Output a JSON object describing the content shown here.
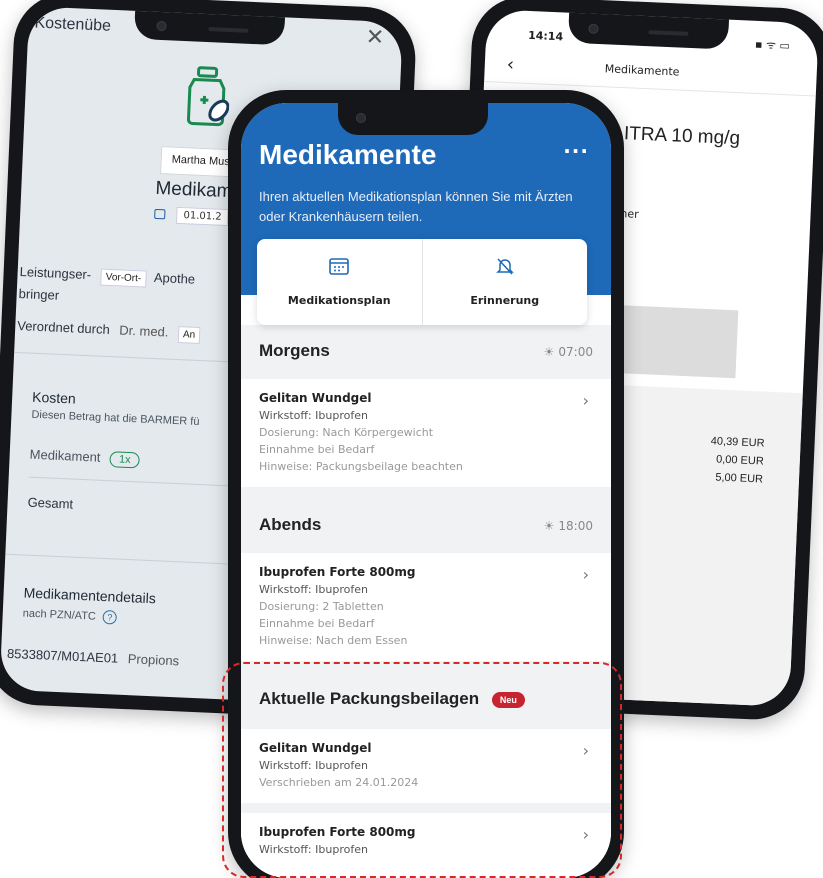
{
  "left_phone": {
    "title": "Kostenübe",
    "close": "✕",
    "patient_name": "Martha Mus",
    "heading": "Medikam",
    "date": "01.01.2",
    "provider_label_1": "Leistungser-",
    "provider_label_2": "bringer",
    "provider_chip": "Vor-Ort-",
    "provider_value": "Apothe",
    "prescribed_label": "Verordnet durch",
    "prescribed_value": "Dr. med.",
    "prescribed_chip": "An",
    "costs_label": "Kosten",
    "costs_desc": "Diesen Betrag hat die BARMER fü",
    "medication_label": "Medikament",
    "medication_count": "1x",
    "total_label": "Gesamt",
    "details_label": "Medikamentendetails",
    "details_sub": "nach PZN/ATC",
    "help": "?",
    "pzn": "8533807/M01AE01",
    "pzn_suffix": "Propions"
  },
  "right_phone": {
    "time": "14:14",
    "status": "▪ ᯤ ▭",
    "back": "‹",
    "nav_title": "Medikamente",
    "drug_name": "ITRA 10 mg/g",
    "ner_text": "ner",
    "amounts": [
      "40,39 EUR",
      "0,00 EUR",
      "5,00 EUR"
    ]
  },
  "center_phone": {
    "title": "Medikamente",
    "more": "···",
    "subtitle": "Ihren aktuellen Medikationsplan können Sie mit Ärzten oder Krankenhäusern teilen.",
    "actions": [
      {
        "label": "Medikationsplan",
        "icon": "calendar-icon"
      },
      {
        "label": "Erinnerung",
        "icon": "bell-off-icon"
      }
    ],
    "morning": {
      "heading": "Morgens",
      "time": "07:00",
      "card": {
        "name": "Gelitan Wundgel",
        "substance": "Wirkstoff: Ibuprofen",
        "dosage": "Dosierung: Nach Körpergewicht",
        "intake": "Einnahme bei Bedarf",
        "notes": "Hinweise: Packungsbeilage beachten"
      }
    },
    "evening": {
      "heading": "Abends",
      "time": "18:00",
      "card": {
        "name": "Ibuprofen Forte 800mg",
        "substance": "Wirkstoff: Ibuprofen",
        "dosage": "Dosierung: 2 Tabletten",
        "intake": "Einnahme bei Bedarf",
        "notes": "Hinweise: Nach dem Essen"
      }
    },
    "leaflets": {
      "heading": "Aktuelle Packungsbeilagen",
      "badge": "Neu",
      "items": [
        {
          "name": "Gelitan Wundgel",
          "substance": "Wirkstoff: Ibuprofen",
          "date": "Verschrieben am 24.01.2024"
        },
        {
          "name": "Ibuprofen Forte 800mg",
          "substance": "Wirkstoff: Ibuprofen"
        }
      ]
    },
    "chevron": "›"
  },
  "colors": {
    "header_blue": "#1e69b8",
    "badge_red": "#c6252f",
    "highlight_red": "#d42a2a",
    "pill_green": "#188a50"
  }
}
